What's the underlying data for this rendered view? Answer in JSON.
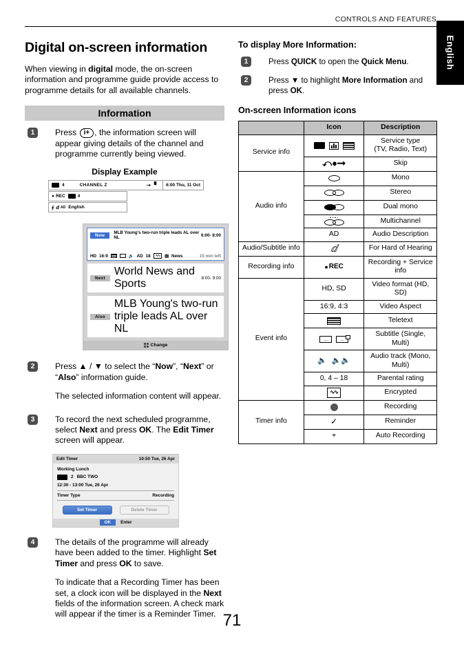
{
  "header": {
    "running_head": "CONTROLS AND FEATURES",
    "language_tab": "English"
  },
  "page_number": "71",
  "left_column": {
    "title": "Digital on-screen information",
    "intro_html": "When viewing in <b>digital</b> mode, the on-screen information and programme guide provide access to programme details for all available channels.",
    "section_bar": "Information",
    "steps": [
      {
        "num": "1",
        "text_html": "Press <span class=\"keycap\">i+</span>, the information screen will appear giving details of the channel and programme currently being viewed."
      },
      {
        "num": "2",
        "text_html": "Press ▲ / ▼ to select the “<b>Now</b>”, “<b>Next</b>” or “<b>Also</b>” information guide.",
        "text2_html": "The selected information content will appear."
      },
      {
        "num": "3",
        "text_html": "To record the next scheduled programme, select <b>Next</b> and press <b>OK</b>. The <b>Edit Timer</b> screen will appear."
      },
      {
        "num": "4",
        "text_html": "The details of the programme will already have been added to the timer. Highlight <b>Set Timer</b> and press <b>OK</b> to save.",
        "text2_html": "To indicate that a Recording Timer has been set, a clock icon will be displayed in the <b>Next</b> fields of the information screen. A check mark will appear if the timer is a Reminder Timer."
      }
    ],
    "display_example": {
      "caption": "Display Example",
      "row1": {
        "channel_number": "4",
        "channel_name": "CHANNEL Z",
        "time": "6:00 Thu, 11 Oct"
      },
      "row2": {
        "rec_label": "REC",
        "channel_number": "4"
      },
      "row3": {
        "audio_label": "AD",
        "language": "English"
      }
    },
    "guide_mock": {
      "now": {
        "tag": "Now",
        "title": "MLB Young's two-run triple leads AL over NL",
        "time": "6:00- 8:00",
        "icons": [
          "HD",
          "16:9",
          "AD",
          "18",
          "News"
        ],
        "time_left": "15 min left"
      },
      "next": {
        "tag": "Next",
        "title": "World News and Sports",
        "time": "8:00- 9:00"
      },
      "also": {
        "tag": "Also",
        "title": "MLB Young's two-run triple leads AL over NL"
      },
      "footer": "Change"
    },
    "timer_mock": {
      "title": "Edit Timer",
      "clock": "10:50 Tue, 26 Apr",
      "programme": "Working Lunch",
      "channel_number": "2",
      "channel_name": "BBC  TWO",
      "schedule": "12:30 - 13:00 Tue, 26 Apr",
      "type_label": "Timer Type",
      "type_value": "Recording",
      "set_button": "Set Timer",
      "delete_button": "Delete Timer",
      "ok_chip": "OK",
      "enter_label": "Enter"
    }
  },
  "right_column": {
    "heading": "To display More Information:",
    "steps": [
      {
        "num": "1",
        "text_html": "Press <b>QUICK</b> to open the <b>Quick Menu</b>."
      },
      {
        "num": "2",
        "text_html": "Press ▼ to highlight <b>More Information</b> and press <b>OK</b>."
      }
    ],
    "table_heading": "On-screen Information icons",
    "table": {
      "columns": [
        "",
        "Icon",
        "Description"
      ],
      "rows": [
        {
          "category": "Service info",
          "rowspan": 2,
          "icon_type": "service-type",
          "icon_text": "",
          "description": "Service type\n(TV, Radio, Text)"
        },
        {
          "category": "",
          "icon_type": "skip",
          "icon_text": "",
          "description": "Skip"
        },
        {
          "category": "Audio info",
          "rowspan": 5,
          "icon_type": "mono",
          "icon_text": "",
          "description": "Mono"
        },
        {
          "category": "",
          "icon_type": "stereo",
          "icon_text": "",
          "description": "Stereo"
        },
        {
          "category": "",
          "icon_type": "dual-mono",
          "icon_text": "",
          "description": "Dual mono"
        },
        {
          "category": "",
          "icon_type": "multichannel",
          "icon_text": "",
          "description": "Multichannel"
        },
        {
          "category": "",
          "icon_type": "text",
          "icon_text": "AD",
          "description": "Audio Description"
        },
        {
          "category": "Audio/Subtitle info",
          "rowspan": 1,
          "icon_type": "hard-of-hearing",
          "icon_text": "",
          "description": "For Hard of Hearing"
        },
        {
          "category": "Recording info",
          "rowspan": 1,
          "icon_type": "rec",
          "icon_text": "REC",
          "description": "Recording + Service info"
        },
        {
          "category": "Event info",
          "rowspan": 7,
          "icon_type": "text",
          "icon_text": "HD, SD",
          "description": "Video format (HD, SD)"
        },
        {
          "category": "",
          "icon_type": "text",
          "icon_text": "16:9, 4:3",
          "description": "Video Aspect"
        },
        {
          "category": "",
          "icon_type": "teletext",
          "icon_text": "",
          "description": "Teletext"
        },
        {
          "category": "",
          "icon_type": "subtitle",
          "icon_text": "",
          "description": "Subtitle (Single, Multi)"
        },
        {
          "category": "",
          "icon_type": "audio-track",
          "icon_text": "",
          "description": "Audio track (Mono, Multi)"
        },
        {
          "category": "",
          "icon_type": "text",
          "icon_text": "0, 4 – 18",
          "description": "Parental rating"
        },
        {
          "category": "",
          "icon_type": "encrypted",
          "icon_text": "",
          "description": "Encrypted"
        },
        {
          "category": "Timer info",
          "rowspan": 3,
          "icon_type": "clock-filled",
          "icon_text": "",
          "description": "Recording"
        },
        {
          "category": "",
          "icon_type": "check",
          "icon_text": "",
          "description": "Reminder"
        },
        {
          "category": "",
          "icon_type": "auto-clock",
          "icon_text": "",
          "description": "Auto Recording"
        }
      ]
    }
  }
}
